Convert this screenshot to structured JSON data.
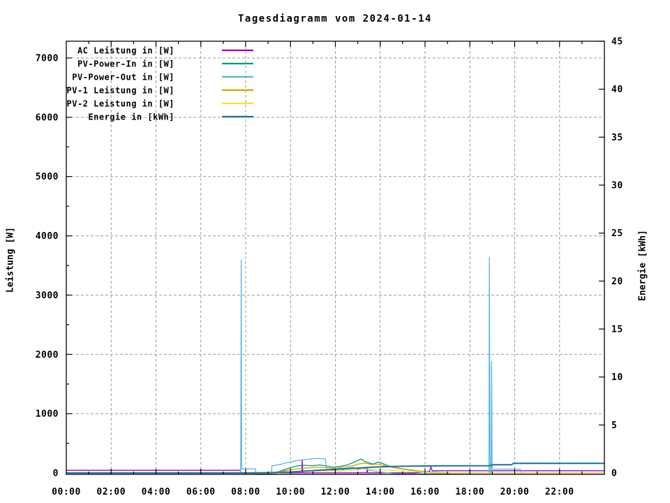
{
  "title": "Tagesdiagramm vom 2024-01-14",
  "chart_data": {
    "type": "line",
    "title": "Tagesdiagramm vom 2024-01-14",
    "xlabel": "",
    "ylabel": "Leistung [W]",
    "y2label": "Energie [kWh]",
    "x_unit": "hours",
    "xlim": [
      0,
      24
    ],
    "ylim": [
      0,
      7283
    ],
    "y2lim": [
      0,
      45
    ],
    "x_tick_labels": [
      "00:00",
      "02:00",
      "04:00",
      "06:00",
      "08:00",
      "10:00",
      "12:00",
      "14:00",
      "16:00",
      "18:00",
      "20:00",
      "22:00"
    ],
    "x_tick_hours": [
      0,
      2,
      4,
      6,
      8,
      10,
      12,
      14,
      16,
      18,
      20,
      22
    ],
    "y_ticks": [
      0,
      1000,
      2000,
      3000,
      4000,
      5000,
      6000,
      7000
    ],
    "y2_ticks": [
      0,
      5,
      10,
      15,
      20,
      25,
      30,
      35,
      40,
      45
    ],
    "grid": {
      "show": true,
      "color": "#9b9b9b",
      "style": "dashed"
    },
    "legend_position": "top-left",
    "background": "#ffffff",
    "series": [
      {
        "name": "AC Leistung in [W]",
        "color": "#9400d3",
        "axis": "y1",
        "points": [
          [
            0,
            45
          ],
          [
            7.78,
            45
          ],
          [
            7.78,
            2
          ],
          [
            10.5,
            2
          ],
          [
            10.52,
            230
          ],
          [
            10.55,
            2
          ],
          [
            13.4,
            2
          ],
          [
            13.42,
            90
          ],
          [
            13.45,
            2
          ],
          [
            15.5,
            2
          ],
          [
            15.9,
            12
          ],
          [
            16.2,
            28
          ],
          [
            16.26,
            105
          ],
          [
            16.32,
            38
          ],
          [
            24,
            38
          ]
        ]
      },
      {
        "name": "PV-Power-In in [W]",
        "color": "#009977",
        "axis": "y1",
        "points": [
          [
            0,
            0
          ],
          [
            9.3,
            0
          ],
          [
            9.6,
            40
          ],
          [
            10,
            90
          ],
          [
            10.3,
            120
          ],
          [
            10.6,
            130
          ],
          [
            11,
            122
          ],
          [
            11.3,
            135
          ],
          [
            11.6,
            118
          ],
          [
            11.9,
            95
          ],
          [
            12.2,
            110
          ],
          [
            12.5,
            132
          ],
          [
            12.8,
            175
          ],
          [
            13,
            210
          ],
          [
            13.15,
            235
          ],
          [
            13.3,
            195
          ],
          [
            13.5,
            170
          ],
          [
            13.7,
            150
          ],
          [
            13.9,
            185
          ],
          [
            14.1,
            160
          ],
          [
            14.35,
            120
          ],
          [
            14.6,
            95
          ],
          [
            15,
            70
          ],
          [
            15.4,
            50
          ],
          [
            15.8,
            30
          ],
          [
            16.2,
            15
          ],
          [
            16.8,
            5
          ],
          [
            17.2,
            0
          ],
          [
            24,
            0
          ]
        ]
      },
      {
        "name": "PV-Power-Out in [W]",
        "color": "#5ab4e5",
        "axis": "y1",
        "points": [
          [
            0,
            0
          ],
          [
            7.78,
            0
          ],
          [
            7.8,
            3600
          ],
          [
            7.82,
            70
          ],
          [
            8.44,
            70
          ],
          [
            8.46,
            -25
          ],
          [
            9.15,
            -25
          ],
          [
            9.17,
            120
          ],
          [
            9.5,
            140
          ],
          [
            9.8,
            170
          ],
          [
            10.1,
            195
          ],
          [
            10.4,
            215
          ],
          [
            10.7,
            230
          ],
          [
            11,
            240
          ],
          [
            11.3,
            245
          ],
          [
            11.55,
            235
          ],
          [
            11.62,
            60
          ],
          [
            11.9,
            45
          ],
          [
            12.2,
            30
          ],
          [
            12.5,
            80
          ],
          [
            12.8,
            95
          ],
          [
            13,
            60
          ],
          [
            13.2,
            85
          ],
          [
            13.5,
            50
          ],
          [
            13.8,
            25
          ],
          [
            14.2,
            8
          ],
          [
            14.6,
            -10
          ],
          [
            15.2,
            -15
          ],
          [
            16.5,
            -12
          ],
          [
            17.5,
            -6
          ],
          [
            18.85,
            0
          ],
          [
            18.87,
            3650
          ],
          [
            18.9,
            0
          ],
          [
            18.95,
            0
          ],
          [
            18.97,
            1880
          ],
          [
            18.99,
            65
          ],
          [
            20.25,
            65
          ],
          [
            20.27,
            0
          ],
          [
            24,
            0
          ]
        ]
      },
      {
        "name": "PV-1 Leistung in [W]",
        "color": "#dda000",
        "axis": "y1",
        "points": [
          [
            0,
            0
          ],
          [
            8.2,
            0
          ],
          [
            8.25,
            -18
          ],
          [
            9.3,
            -18
          ],
          [
            9.5,
            20
          ],
          [
            10,
            55
          ],
          [
            10.4,
            75
          ],
          [
            10.8,
            85
          ],
          [
            11.2,
            95
          ],
          [
            11.6,
            90
          ],
          [
            12,
            75
          ],
          [
            12.4,
            95
          ],
          [
            12.8,
            125
          ],
          [
            13.1,
            155
          ],
          [
            13.35,
            165
          ],
          [
            13.6,
            140
          ],
          [
            13.9,
            150
          ],
          [
            14.2,
            120
          ],
          [
            14.6,
            90
          ],
          [
            15,
            65
          ],
          [
            15.4,
            45
          ],
          [
            15.8,
            28
          ],
          [
            16.2,
            12
          ],
          [
            16.6,
            -8
          ],
          [
            17.4,
            -8
          ],
          [
            17.5,
            0
          ],
          [
            24,
            0
          ]
        ]
      },
      {
        "name": "PV-2 Leistung in [W]",
        "color": "#efe33e",
        "axis": "y1",
        "points": [
          [
            0,
            0
          ],
          [
            9.3,
            0
          ],
          [
            9.8,
            10
          ],
          [
            10.3,
            20
          ],
          [
            10.8,
            28
          ],
          [
            11.3,
            33
          ],
          [
            11.8,
            30
          ],
          [
            12.3,
            38
          ],
          [
            12.8,
            48
          ],
          [
            13.2,
            58
          ],
          [
            13.6,
            62
          ],
          [
            14,
            52
          ],
          [
            14.5,
            44
          ],
          [
            15,
            32
          ],
          [
            15.5,
            22
          ],
          [
            16,
            12
          ],
          [
            16.5,
            5
          ],
          [
            17,
            0
          ],
          [
            24,
            0
          ]
        ]
      },
      {
        "name": "Energie in [kWh]",
        "color": "#19709f",
        "axis": "y2",
        "points": [
          [
            0,
            0
          ],
          [
            8,
            0
          ],
          [
            9,
            0.03
          ],
          [
            10,
            0.1
          ],
          [
            11,
            0.25
          ],
          [
            12,
            0.38
          ],
          [
            13,
            0.5
          ],
          [
            13.5,
            0.58
          ],
          [
            14,
            0.64
          ],
          [
            15,
            0.7
          ],
          [
            16,
            0.73
          ],
          [
            17,
            0.75
          ],
          [
            18.9,
            0.76
          ],
          [
            19.0,
            0.85
          ],
          [
            19.85,
            0.85
          ],
          [
            19.95,
            1.0
          ],
          [
            24,
            1.0
          ]
        ]
      }
    ]
  }
}
